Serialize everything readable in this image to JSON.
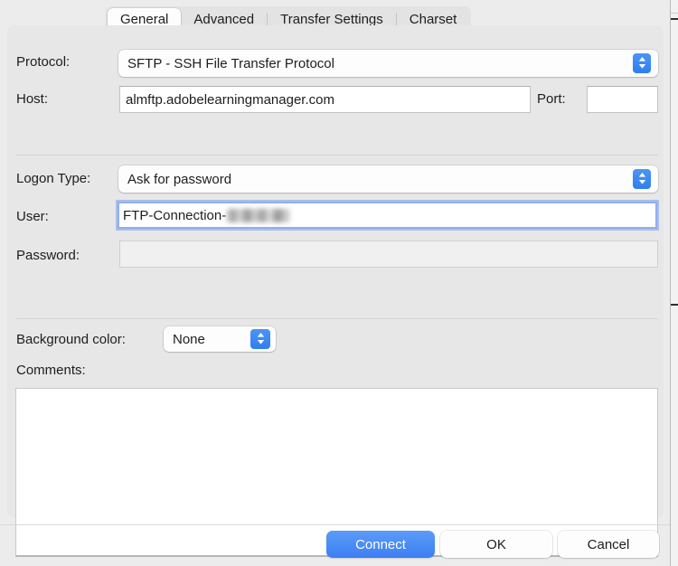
{
  "tabs": [
    {
      "label": "General",
      "selected": true
    },
    {
      "label": "Advanced",
      "selected": false
    },
    {
      "label": "Transfer Settings",
      "selected": false
    },
    {
      "label": "Charset",
      "selected": false
    }
  ],
  "form": {
    "protocol": {
      "label": "Protocol:",
      "value": "SFTP - SSH File Transfer Protocol",
      "stepper_icon": "chevron-up-down-icon"
    },
    "host": {
      "label": "Host:",
      "value": "almftp.adobelearningmanager.com",
      "placeholder": ""
    },
    "port": {
      "label": "Port:",
      "value": "",
      "placeholder": ""
    },
    "logon_type": {
      "label": "Logon Type:",
      "value": "Ask for password",
      "stepper_icon": "chevron-up-down-icon"
    },
    "user": {
      "label": "User:",
      "value": "FTP-Connection-",
      "redacted_suffix": true,
      "focused": true,
      "placeholder": ""
    },
    "password": {
      "label": "Password:",
      "value": "",
      "disabled": true,
      "placeholder": ""
    },
    "background_color": {
      "label": "Background color:",
      "value": "None",
      "stepper_icon": "chevron-up-down-icon"
    },
    "comments": {
      "label": "Comments:",
      "value": "",
      "placeholder": ""
    }
  },
  "buttons": {
    "connect": "Connect",
    "ok": "OK",
    "cancel": "Cancel"
  },
  "colors": {
    "accent": "#3d7ff2",
    "window_bg": "#ececec",
    "panel_bg": "#e7e7e7",
    "focus_ring": "#8fb0ec",
    "field_bg": "#ffffff",
    "disabled_field_bg": "#f0f0f0"
  }
}
